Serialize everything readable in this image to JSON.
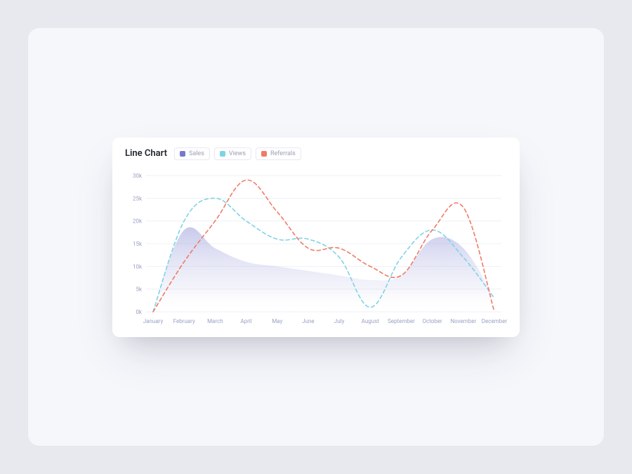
{
  "title": "Line Chart",
  "legend": {
    "sales": "Sales",
    "views": "Views",
    "referrals": "Referrals"
  },
  "chart_data": {
    "type": "line",
    "categories": [
      "January",
      "February",
      "March",
      "April",
      "May",
      "June",
      "July",
      "August",
      "September",
      "October",
      "November",
      "December"
    ],
    "series": [
      {
        "name": "Sales",
        "style": "area",
        "color": "#7479cf",
        "values": [
          1,
          18,
          14,
          11,
          10,
          9,
          8,
          7,
          8,
          16,
          14,
          3
        ]
      },
      {
        "name": "Views",
        "style": "dashed",
        "color": "#7fd3e6",
        "values": [
          0,
          20,
          25,
          20,
          16,
          16,
          12,
          1,
          12,
          18,
          12,
          3
        ]
      },
      {
        "name": "Referrals",
        "style": "dashed",
        "color": "#f07a66",
        "values": [
          0,
          11,
          20,
          29,
          22,
          14,
          14,
          10,
          8,
          18,
          23,
          0
        ]
      }
    ],
    "xlabel": "",
    "ylabel": "",
    "ylim": [
      0,
      30
    ],
    "y_ticks": [
      "0k",
      "5k",
      "10k",
      "15k",
      "20k",
      "25k",
      "30k"
    ]
  }
}
